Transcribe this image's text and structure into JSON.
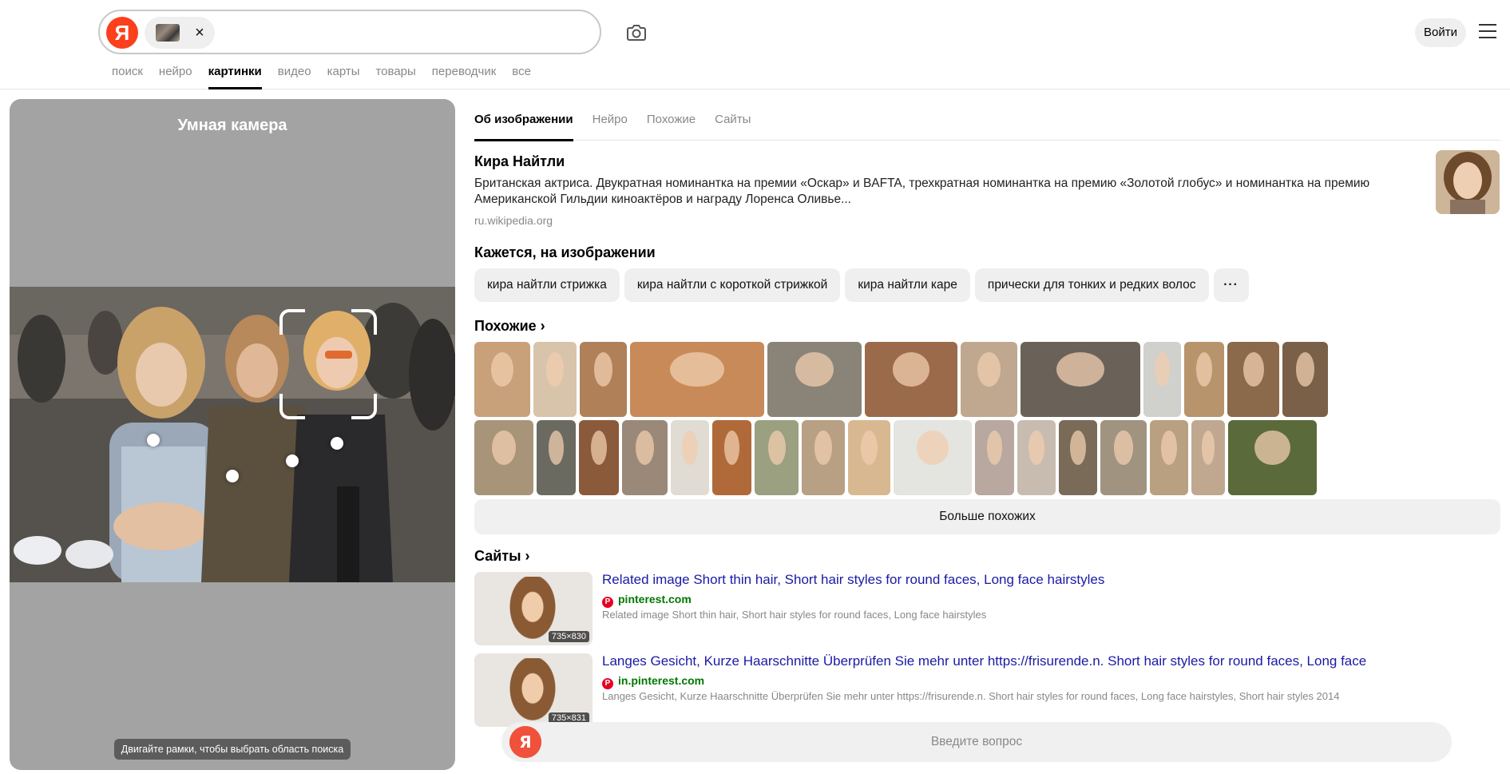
{
  "header": {
    "logo_letter": "Я",
    "chip_close": "×",
    "login_label": "Войти"
  },
  "nav": {
    "tabs": [
      {
        "label": "поиск",
        "active": false
      },
      {
        "label": "нейро",
        "active": false
      },
      {
        "label": "картинки",
        "active": true
      },
      {
        "label": "видео",
        "active": false
      },
      {
        "label": "карты",
        "active": false
      },
      {
        "label": "товары",
        "active": false
      },
      {
        "label": "переводчик",
        "active": false
      },
      {
        "label": "все",
        "active": false
      }
    ]
  },
  "camera": {
    "title": "Умная камера",
    "hint": "Двигайте рамки, чтобы выбрать область поиска"
  },
  "result": {
    "tabs": [
      {
        "label": "Об изображении",
        "active": true
      },
      {
        "label": "Нейро",
        "active": false
      },
      {
        "label": "Похожие",
        "active": false
      },
      {
        "label": "Сайты",
        "active": false
      }
    ],
    "entity": {
      "name": "Кира Найтли",
      "description": "Британская актриса. Двукратная номинантка на премии «Оскар» и BAFTA, трехкратная номинантка на премию «Золотой глобус» и номинантка на премию Американской Гильдии киноактёров и награду Лоренса Оливье...",
      "source": "ru.wikipedia.org"
    },
    "seems_title": "Кажется, на изображении",
    "chips": [
      "кира найтли стрижка",
      "кира найтли с короткой стрижкой",
      "кира найтли каре",
      "прически для тонких и редких волос"
    ],
    "chips_more": "···",
    "similar_title": "Похожие",
    "similar_row1": [
      "#c8a07a",
      "#d8c4aa",
      "#b08058",
      "#c88a58",
      "#8a8478",
      "#9a6a4a",
      "#c0a890",
      "#6a6258",
      "#d0d0cc",
      "#b8946c",
      "#8a6a4a",
      "#7a6048",
      "#a88a6a"
    ],
    "similar_row2": [
      "#a89478",
      "#6a6a60",
      "#8a5a3a",
      "#9a8878",
      "#e0dcd4",
      "#b06a3a",
      "#9aa080",
      "#b8a084",
      "#d8b890",
      "#e4e4e0",
      "#b8a8a0",
      "#c8bcb0",
      "#7a6a58",
      "#a09480",
      "#b8a080",
      "#c0a890",
      "#5a6a3a"
    ],
    "similar_widths_row1": [
      70,
      54,
      59,
      168,
      118,
      116,
      71,
      150,
      47,
      50,
      65,
      57
    ],
    "similar_widths_row2": [
      74,
      49,
      50,
      57,
      48,
      49,
      55,
      54,
      53,
      98,
      49,
      48,
      48,
      58,
      48,
      42,
      111
    ],
    "more_similar": "Больше похожих",
    "sites_title": "Сайты",
    "sites": [
      {
        "title": "Related image Short thin hair, Short hair styles for round faces, Long face hairstyles",
        "domain": "pinterest.com",
        "snippet": "Related image Short thin hair, Short hair styles for round faces, Long face hairstyles",
        "dims": "735×830"
      },
      {
        "title": "Langes Gesicht, Kurze Haarschnitte Überprüfen Sie mehr unter https://frisurende.n. Short hair styles for round faces, Long face",
        "domain": "in.pinterest.com",
        "snippet": "Langes Gesicht, Kurze Haarschnitte Überprüfen Sie mehr unter https://frisurende.n. Short hair styles for round faces, Long face hairstyles, Short hair styles 2014",
        "dims": "735×831"
      }
    ],
    "ask_placeholder": "Введите вопрос"
  }
}
